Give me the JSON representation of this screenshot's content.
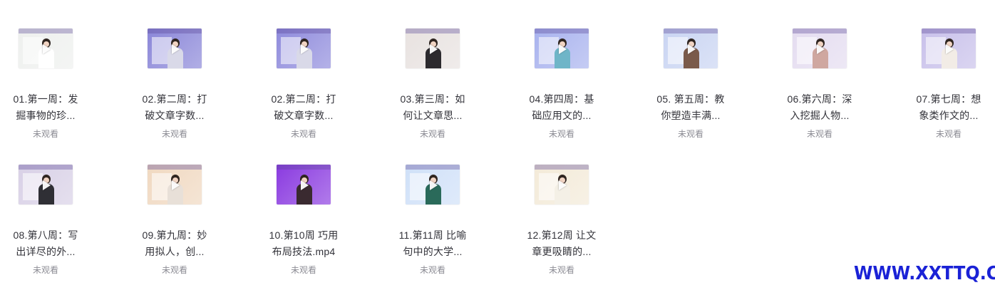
{
  "items": [
    {
      "line1": "01.第一周：发",
      "line2": "掘事物的珍...",
      "status": "未观看",
      "bg": "#eef0ee",
      "torso": "#ffffff",
      "panel": true
    },
    {
      "line1": "02.第二周：打",
      "line2": "破文章字数...",
      "status": "未观看",
      "bg": "#8a86d8",
      "torso": "#d9d9e8",
      "panel": true
    },
    {
      "line1": "02.第二周：打",
      "line2": "破文章字数...",
      "status": "未观看",
      "bg": "#8f8bdc",
      "torso": "#d9d9e8",
      "panel": true
    },
    {
      "line1": "03.第三周：如",
      "line2": "何让文章思...",
      "status": "未观看",
      "bg": "#e8e2e0",
      "torso": "#2c2a2e",
      "panel": false
    },
    {
      "line1": "04.第四周：基",
      "line2": "础应用文的...",
      "status": "未观看",
      "bg": "#a8b2ee",
      "torso": "#6fb5c8",
      "panel": true
    },
    {
      "line1": "05. 第五周：教",
      "line2": "你塑造丰满...",
      "status": "未观看",
      "bg": "#c9d4f2",
      "torso": "#7a5a4a",
      "panel": true
    },
    {
      "line1": "06.第六周：深",
      "line2": "入挖掘人物...",
      "status": "未观看",
      "bg": "#e4dcf0",
      "torso": "#cfa7a0",
      "panel": true
    },
    {
      "line1": "07.第七周：想",
      "line2": "象类作文的...",
      "status": "未观看",
      "bg": "#c8c0ea",
      "torso": "#f2ece6",
      "panel": true
    },
    {
      "line1": "08.第八周：写",
      "line2": "出详尽的外...",
      "status": "未观看",
      "bg": "#d8d0e6",
      "torso": "#2f2f35",
      "panel": true
    },
    {
      "line1": "09.第九周：妙",
      "line2": "用拟人，创...",
      "status": "未观看",
      "bg": "#f0d8c0",
      "torso": "#e8e0d8",
      "panel": true
    },
    {
      "line1": "10.第10周 巧用",
      "line2": "布局技法.mp4",
      "status": "未观看",
      "bg": "#8a3ae0",
      "torso": "#3a2a30",
      "panel": false
    },
    {
      "line1": "11.第11周 比喻",
      "line2": "句中的大学...",
      "status": "未观看",
      "bg": "#cfe0f8",
      "torso": "#2a6a5a",
      "panel": true
    },
    {
      "line1": "12.第12周 让文",
      "line2": "章更吸睛的...",
      "status": "未观看",
      "bg": "#f3ead8",
      "torso": "#f4f0e6",
      "panel": true
    }
  ],
  "watermark": "WWW.XXTTQ.COM"
}
